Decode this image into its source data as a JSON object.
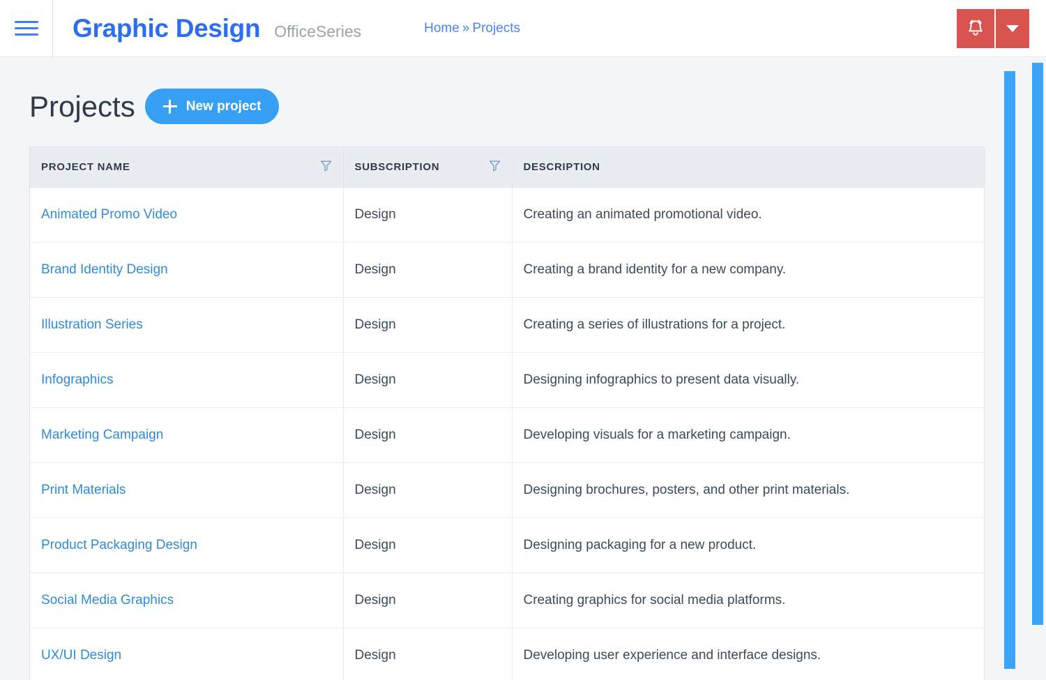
{
  "navbar": {
    "menu_icon": "hamburger-icon",
    "brand_title": "Graphic Design",
    "brand_subtitle": "OfficeSeries",
    "breadcrumb": {
      "home": "Home",
      "separator": "»",
      "current": "Projects"
    },
    "actions": {
      "alert_icon": "bell-icon",
      "caret_icon": "chevron-down-icon",
      "accent_color": "#d9534f"
    }
  },
  "main": {
    "page_title": "Projects",
    "new_project_label": "New project",
    "new_project_icon": "plus-icon",
    "accent_color": "#37a0f4",
    "table": {
      "columns": [
        {
          "label": "PROJECT NAME",
          "filter_icon": "filter-funnel-icon",
          "has_filter": true
        },
        {
          "label": "SUBSCRIPTION",
          "filter_icon": "filter-funnel-icon",
          "has_filter": true
        },
        {
          "label": "DESCRIPTION",
          "filter_icon": "",
          "has_filter": false
        }
      ],
      "rows": [
        {
          "name": "Animated Promo Video",
          "subscription": "Design",
          "description": "Creating an animated promotional video."
        },
        {
          "name": "Brand Identity Design",
          "subscription": "Design",
          "description": "Creating a brand identity for a new company."
        },
        {
          "name": "Illustration Series",
          "subscription": "Design",
          "description": "Creating a series of illustrations for a project."
        },
        {
          "name": "Infographics",
          "subscription": "Design",
          "description": "Designing infographics to present data visually."
        },
        {
          "name": "Marketing Campaign",
          "subscription": "Design",
          "description": "Developing visuals for a marketing campaign."
        },
        {
          "name": "Print Materials",
          "subscription": "Design",
          "description": "Designing brochures, posters, and other print materials."
        },
        {
          "name": "Product Packaging Design",
          "subscription": "Design",
          "description": "Designing packaging for a new product."
        },
        {
          "name": "Social Media Graphics",
          "subscription": "Design",
          "description": "Creating graphics for social media platforms."
        },
        {
          "name": "UX/UI Design",
          "subscription": "Design",
          "description": "Developing user experience and interface designs."
        }
      ]
    }
  },
  "scrollbars": {
    "page_scrollbar": "vertical-scrollbar",
    "content_scrollbar": "vertical-scrollbar",
    "color": "#3fa3f7"
  }
}
